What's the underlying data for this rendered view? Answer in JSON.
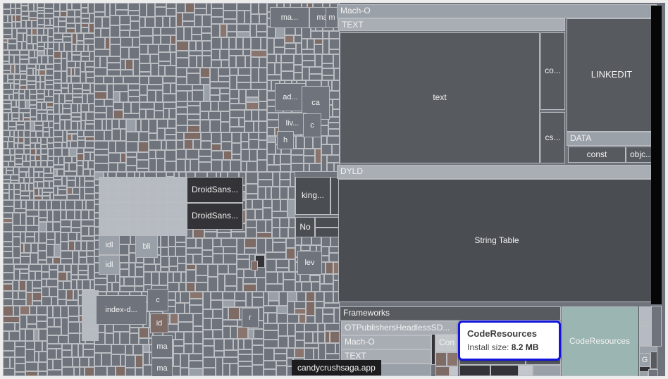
{
  "app": {
    "hovered_node_label": "candycrushsaga.app"
  },
  "tooltip": {
    "title": "CodeResources",
    "metric_label": "Install size:",
    "metric_value": "8.2 MB",
    "border_color": "#1414e0"
  },
  "palette": {
    "base": "#6f747c",
    "light": "#a8adb4",
    "dark": "#575b60",
    "black": "#343438",
    "brown": "#7e6b66",
    "teal": "#9bb5b2",
    "header": "#9ba1a8",
    "stroke": "#b9bcc0",
    "page_bg": "#ededed",
    "scrollbar_track": "#060606"
  },
  "treemap": {
    "root_label": "candycrushsaga.app",
    "right_panel": {
      "macho_header": "Mach-O",
      "text_header": "TEXT",
      "dyld_header": "DYLD",
      "data_header": "DATA",
      "frameworks_header": "Frameworks",
      "nodes": [
        {
          "label": "text"
        },
        {
          "label": "co..."
        },
        {
          "label": "cs..."
        },
        {
          "label": "LINKEDIT"
        },
        {
          "label": "const"
        },
        {
          "label": "objc..."
        },
        {
          "label": "String Table"
        },
        {
          "label": "OTPublishersHeadlessSD..."
        },
        {
          "label": "Mach-O"
        },
        {
          "label": "TEXT"
        },
        {
          "label": "Con"
        },
        {
          "label": "CodeResources"
        },
        {
          "label": "G"
        }
      ]
    },
    "left_panel": {
      "nodes": [
        {
          "label": "ma..."
        },
        {
          "label": "ma"
        },
        {
          "label": "m"
        },
        {
          "label": "ad..."
        },
        {
          "label": "ca"
        },
        {
          "label": "liv..."
        },
        {
          "label": "c"
        },
        {
          "label": "h"
        },
        {
          "label": "DroidSans..."
        },
        {
          "label": "DroidSans..."
        },
        {
          "label": "king..."
        },
        {
          "label": "No"
        },
        {
          "label": "idl"
        },
        {
          "label": "idl"
        },
        {
          "label": "bli"
        },
        {
          "label": "lev"
        },
        {
          "label": "index-d..."
        },
        {
          "label": "c"
        },
        {
          "label": "id"
        },
        {
          "label": "ma"
        },
        {
          "label": "ma"
        },
        {
          "label": "r"
        }
      ]
    }
  }
}
